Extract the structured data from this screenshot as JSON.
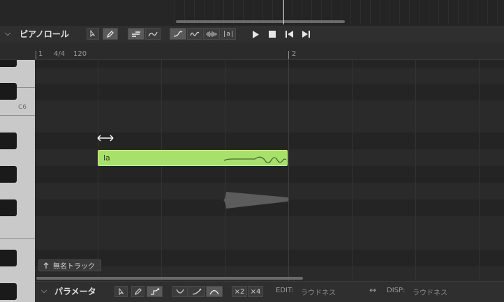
{
  "piano_roll": {
    "title": "ピアノロール",
    "tools": [
      "pointer-tool",
      "pencil-tool",
      "note-edit-tool",
      "pitch-edit-tool"
    ],
    "view_buttons": [
      "curve-view",
      "wave-view",
      "spectrum-view",
      "lyric-view"
    ],
    "lyric_view_label": "|a|"
  },
  "ruler": {
    "bar1": "1",
    "time_signature": "4/4",
    "tempo": "120",
    "bar2": "2"
  },
  "keyboard": {
    "c_label": "C6"
  },
  "note": {
    "lyric": "la",
    "color": "#a7e06a"
  },
  "track": {
    "name": "無名トラック"
  },
  "parameters": {
    "title": "パラメータ",
    "mult2": "×2",
    "mult4": "×4",
    "edit_label": "EDIT:",
    "edit_value": "ラウドネス",
    "swap_icon": "↔",
    "disp_label": "DISP:",
    "disp_value": "ラウドネス"
  }
}
